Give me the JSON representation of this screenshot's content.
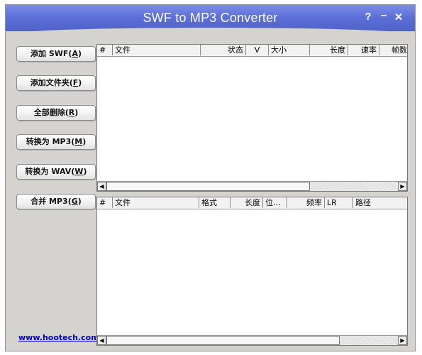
{
  "window": {
    "title": "SWF to MP3 Converter",
    "controls": {
      "help": "?",
      "minimize": "–",
      "close": "✕"
    }
  },
  "buttons": [
    {
      "name": "add-swf-button",
      "label": "添加 SWF(",
      "hotkey": "A",
      "suffix": ")"
    },
    {
      "name": "add-folder-button",
      "label": "添加文件夹(",
      "hotkey": "F",
      "suffix": ")"
    },
    {
      "name": "remove-all-button",
      "label": "全部删除(",
      "hotkey": "R",
      "suffix": ")"
    },
    {
      "name": "convert-mp3-button",
      "label": "转换为 MP3(",
      "hotkey": "M",
      "suffix": ")"
    },
    {
      "name": "convert-wav-button",
      "label": "转换为 WAV(",
      "hotkey": "W",
      "suffix": ")"
    },
    {
      "name": "merge-mp3-button",
      "label": "合并 MP3(",
      "hotkey": "G",
      "suffix": ")"
    }
  ],
  "website_link": "www.hootech.com",
  "top_list": {
    "columns": [
      "#",
      "文件",
      "状态",
      "V",
      "大小",
      "长度",
      "速率",
      "帧数"
    ],
    "rows": []
  },
  "bottom_list": {
    "columns": [
      "#",
      "文件",
      "格式",
      "长度",
      "位...",
      "频率",
      "LR",
      "路径"
    ],
    "rows": []
  },
  "scroll_arrows": {
    "left": "◀",
    "right": "▶"
  }
}
